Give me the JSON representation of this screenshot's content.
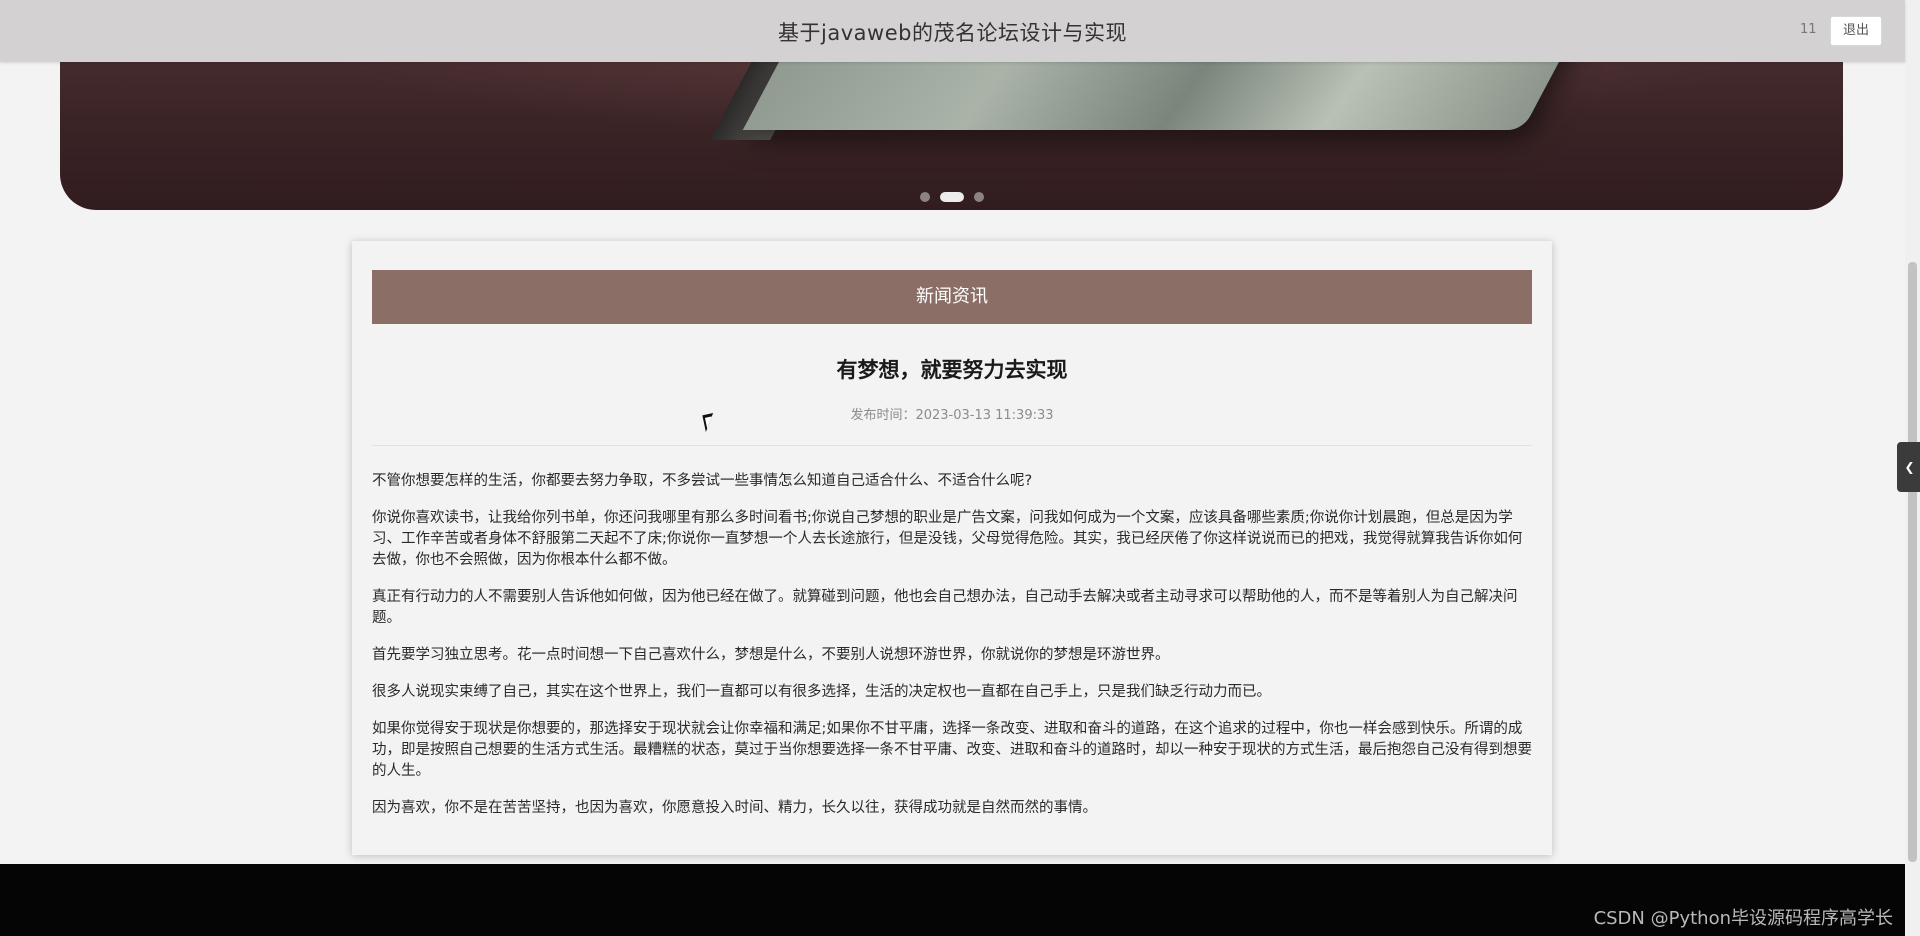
{
  "header": {
    "title": "基于javaweb的茂名论坛设计与实现",
    "username": "11",
    "logout_label": "退出"
  },
  "banner": {
    "slide_count": 3,
    "active_slide": 2
  },
  "news": {
    "section_label": "新闻资讯",
    "article": {
      "title": "有梦想，就要努力去实现",
      "meta": "发布时间：2023-03-13 11:39:33",
      "paragraphs": [
        "不管你想要怎样的生活，你都要去努力争取，不多尝试一些事情怎么知道自己适合什么、不适合什么呢?",
        "你说你喜欢读书，让我给你列书单，你还问我哪里有那么多时间看书;你说自己梦想的职业是广告文案，问我如何成为一个文案，应该具备哪些素质;你说你计划晨跑，但总是因为学习、工作辛苦或者身体不舒服第二天起不了床;你说你一直梦想一个人去长途旅行，但是没钱，父母觉得危险。其实，我已经厌倦了你这样说说而已的把戏，我觉得就算我告诉你如何去做，你也不会照做，因为你根本什么都不做。",
        "真正有行动力的人不需要别人告诉他如何做，因为他已经在做了。就算碰到问题，他也会自己想办法，自己动手去解决或者主动寻求可以帮助他的人，而不是等着别人为自己解决问题。",
        "首先要学习独立思考。花一点时间想一下自己喜欢什么，梦想是什么，不要别人说想环游世界，你就说你的梦想是环游世界。",
        "很多人说现实束缚了自己，其实在这个世界上，我们一直都可以有很多选择，生活的决定权也一直都在自己手上，只是我们缺乏行动力而已。",
        "如果你觉得安于现状是你想要的，那选择安于现状就会让你幸福和满足;如果你不甘平庸，选择一条改变、进取和奋斗的道路，在这个追求的过程中，你也一样会感到快乐。所谓的成功，即是按照自己想要的生活方式生活。最糟糕的状态，莫过于当你想要选择一条不甘平庸、改变、进取和奋斗的道路时，却以一种安于现状的方式生活，最后抱怨自己没有得到想要的人生。",
        "因为喜欢，你不是在苦苦坚持，也因为喜欢，你愿意投入时间、精力，长久以往，获得成功就是自然而然的事情。"
      ]
    }
  },
  "side_toggle_icon": "chevron-left-icon",
  "footer": {
    "watermark": "CSDN @Python毕设源码程序高学长"
  },
  "colors": {
    "header_bg": "#d3d1d2",
    "section_bar": "#8b6f66",
    "page_bg": "#f3f3f3",
    "footer_bg": "#050505"
  }
}
